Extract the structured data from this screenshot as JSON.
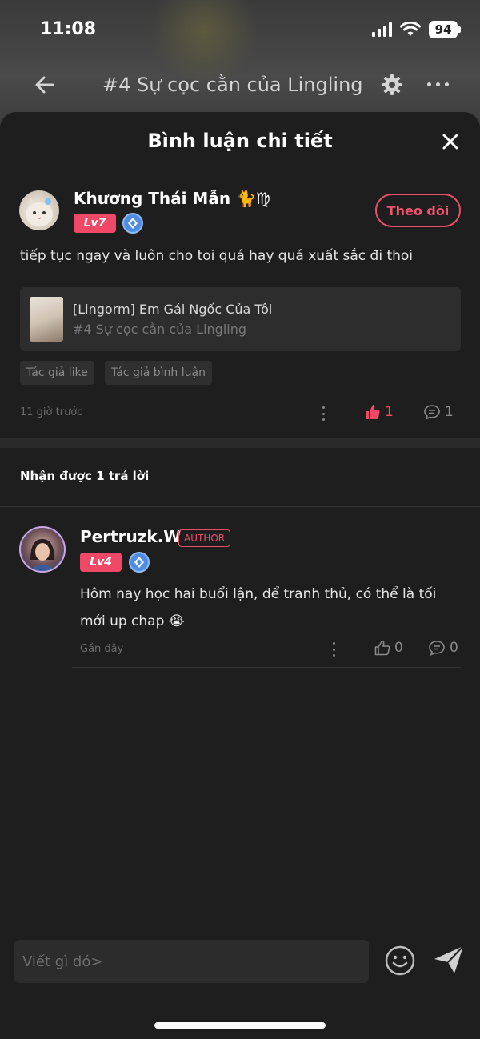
{
  "status_bar": {
    "time": "11:08",
    "battery": "94"
  },
  "nav": {
    "title": "#4 Sự cọc cằn của Lingling"
  },
  "sheet": {
    "title": "Bình luận chi tiết"
  },
  "comment": {
    "username": "Khương Thái Mẫn 🐈♍",
    "level": "Lv7",
    "follow_label": "Theo dõi",
    "text": "tiếp tục ngay và luôn cho toi quá hay quá xuất sắc đi thoi",
    "story": {
      "title": "[Lingorm] Em Gái Ngốc Của Tôi",
      "chapter": "#4 Sự cọc cằn của Lingling"
    },
    "tags": [
      "Tác giả like",
      "Tác giả bình luận"
    ],
    "time": "11 giờ trước",
    "likes": "1",
    "replies": "1"
  },
  "replies_header": "Nhận được 1 trả lời",
  "reply": {
    "username": "Pertruzk.W",
    "author_tag": "AUTHOR",
    "level": "Lv4",
    "text": "Hôm nay học hai buổi lận, để tranh thủ, có thể là tối mới up chap 😭",
    "time": "Gần đây",
    "likes": "0",
    "replies": "0"
  },
  "input": {
    "placeholder": "Viết gì đó>"
  },
  "colors": {
    "accent": "#f04867",
    "sheet_bg": "#1e1e1e",
    "badge_blue": "#4f8de5"
  }
}
